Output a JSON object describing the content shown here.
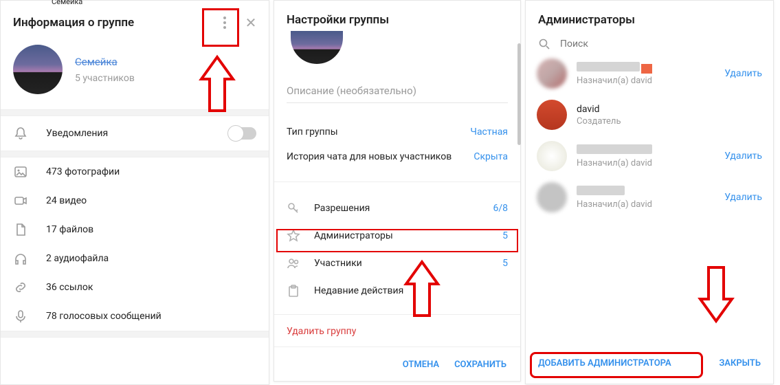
{
  "panel1": {
    "bg_tab_hint": "Семейка",
    "title": "Информация о группе",
    "group_name": "Семейка",
    "members_text": "5 участников",
    "notifications_label": "Уведомления",
    "media": {
      "photos": "473 фотографии",
      "videos": "24 видео",
      "files": "17 файлов",
      "audio": "2 аудиофайла",
      "links": "36 ссылок",
      "voice": "78 голосовых сообщений"
    }
  },
  "panel2": {
    "title": "Настройки группы",
    "description_placeholder": "Описание (необязательно)",
    "group_type_label": "Тип группы",
    "group_type_value": "Частная",
    "history_label": "История чата для новых участников",
    "history_value": "Скрыта",
    "permissions_label": "Разрешения",
    "permissions_value": "6/8",
    "admins_label": "Администраторы",
    "admins_value": "5",
    "members_label": "Участники",
    "members_value": "5",
    "recent_actions_label": "Недавние действия",
    "delete_group": "Удалить группу",
    "cancel": "ОТМЕНА",
    "save": "СОХРАНИТЬ"
  },
  "panel3": {
    "title": "Администраторы",
    "search_placeholder": "Поиск",
    "admins": [
      {
        "name_hidden": true,
        "subtitle": "Назначил(а) david",
        "removable": true
      },
      {
        "name": "david",
        "subtitle": "Создатель",
        "removable": false
      },
      {
        "name_hidden": true,
        "subtitle": "Назначил(а) david",
        "removable": true
      },
      {
        "name_hidden": true,
        "subtitle": "Назначил(а) david",
        "removable": true
      }
    ],
    "delete_label": "Удалить",
    "add_admin": "ДОБАВИТЬ АДМИНИСТРАТОРА",
    "close": "ЗАКРЫТЬ"
  }
}
